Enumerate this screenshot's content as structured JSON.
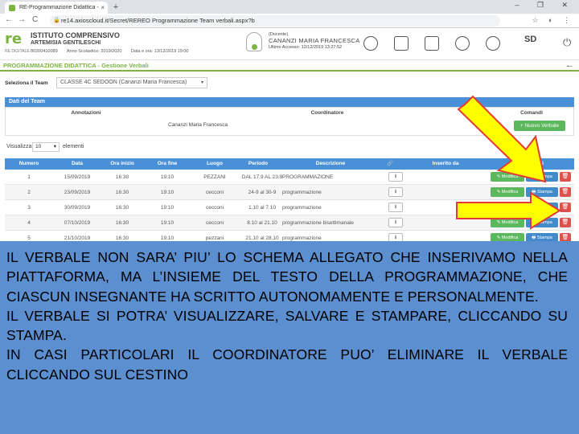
{
  "browser": {
    "tab_title": "RE-Programmazione Didattica -",
    "tab_close": "×",
    "new_tab": "+",
    "window_controls": "– ❐ ✕",
    "nav_back": "←",
    "nav_forward": "→",
    "nav_reload": "C",
    "url": "re14.axioscloud.it/Secret/REREO Programmazione Team verbali.aspx?b",
    "ext_icons": "☆ ◐ ⋮"
  },
  "header": {
    "logo": "re",
    "logo_sub": "RE DIGITALE",
    "school_name": "ISTITUTO COMPRENSIVO",
    "school_sub": "ARTEMISIA GENTILESCHI",
    "school_code": "80200410089",
    "school_year": "Anno Scolastico: 2019/2020",
    "datetime": "Data e ora: 13/12/2019 19:00",
    "user_role": "(Docente)",
    "user_name": "CANANZI MARIA FRANCESCA",
    "last_access": "Ultimo Accesso: 12/12/2019 13:27:52",
    "sd_logo": "SD",
    "power": "⏻"
  },
  "page": {
    "title": "PROGRAMMAZIONE DIDATTICA - Gestione Verbali",
    "back_icon": "←"
  },
  "team_select": {
    "label": "Seleziona il Team",
    "value": "CLASSE 4C SEDOON  (Cananzi Maria Francesca)",
    "caret": "▾"
  },
  "team_panel": {
    "header": "Dati del Team",
    "columns": [
      "Annotazioni",
      "Coordinatore",
      "Comandi"
    ],
    "coordinatore": "Cananzi Maria Francesca",
    "new_button": "+ Nuovo Verbale"
  },
  "visualizza": {
    "label": "Visualizza",
    "value": "10",
    "caret": "▾",
    "suffix": "elementi"
  },
  "table": {
    "columns": [
      "Numero",
      "Data",
      "Ora inizio",
      "Ora fine",
      "Luogo",
      "Periodo",
      "Descrizione",
      "Inserito da",
      "Comandi"
    ],
    "attach_icon": "🔗",
    "download_icon": "⭳",
    "modifica_label": "✎ Modifica",
    "stampa_label": "🖶 Stampa",
    "delete_icon": "🗑",
    "rows": [
      {
        "n": "1",
        "data": "15/09/2019",
        "inizio": "16:30",
        "fine": "19:10",
        "luogo": "PEZZANI",
        "periodo": "DAL 17.9 AL 23.9",
        "descrizione": "PROGRAMMAZIONE"
      },
      {
        "n": "2",
        "data": "23/09/2019",
        "inizio": "16:30",
        "fine": "19:10",
        "luogo": "cecconi",
        "periodo": "24-9 al 30-9",
        "descrizione": "programmazione"
      },
      {
        "n": "3",
        "data": "30/09/2019",
        "inizio": "16:30",
        "fine": "19:10",
        "luogo": "cecconi",
        "periodo": "1.10 al 7.10",
        "descrizione": "programmazione"
      },
      {
        "n": "4",
        "data": "07/10/2019",
        "inizio": "16:30",
        "fine": "19:10",
        "luogo": "cecconi",
        "periodo": "8.10 al 21.10",
        "descrizione": "programmazione bisettimanale"
      },
      {
        "n": "5",
        "data": "21/10/2019",
        "inizio": "16:30",
        "fine": "19:10",
        "luogo": "pezzani",
        "periodo": "21.10 al 28.10",
        "descrizione": "programmazione"
      }
    ]
  },
  "overlay": {
    "p1": "IL VERBALE NON SARA’ PIU’ LO SCHEMA ALLEGATO CHE INSERIVAMO NELLA PIATTAFORMA, MA L’INSIEME DEL TESTO DELLA PROGRAMMAZIONE, CHE CIASCUN INSEGNANTE HA SCRITTO AUTONOMAMENTE E PERSONALMENTE.",
    "p2": "IL VERBALE SI POTRA’ VISUALIZZARE, SALVARE E STAMPARE, CLICCANDO SU STAMPA.",
    "p3": "IN CASI PARTICOLARI IL COORDINATORE PUO’ ELIMINARE IL VERBALE CLICCANDO SUL CESTINO"
  },
  "colors": {
    "green": "#7cb342",
    "table_header": "#4a90d9",
    "overlay_bg": "#5b8fd0",
    "arrow_fill": "#ffff00",
    "arrow_stroke": "#e53935"
  }
}
